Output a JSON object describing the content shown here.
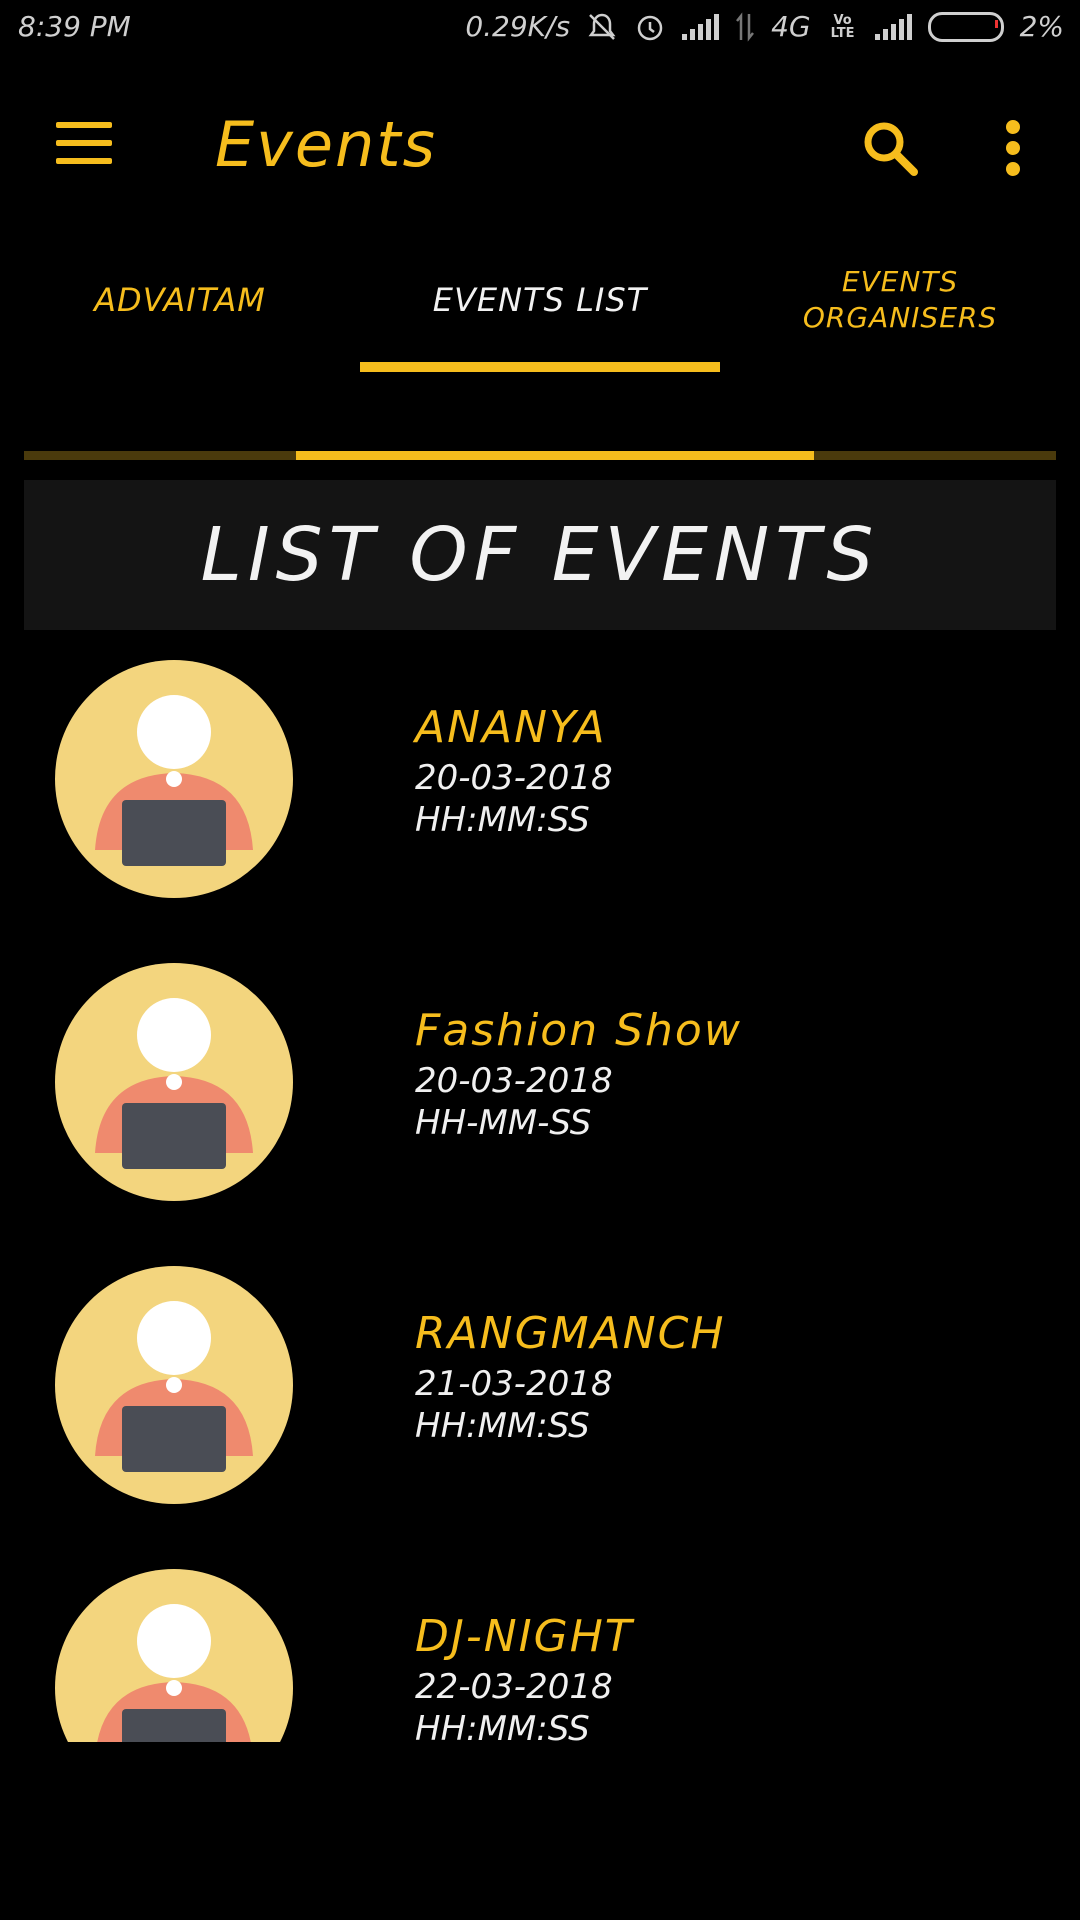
{
  "status_bar": {
    "time": "8:39 PM",
    "speed": "0.29K/s",
    "network": "4G",
    "volte": "Vo LTE",
    "battery": "2%"
  },
  "app_bar": {
    "title": "Events"
  },
  "tabs": [
    {
      "label": "ADVAITAM",
      "selected": false
    },
    {
      "label": "EVENTS LIST",
      "selected": true
    },
    {
      "label": "EVENTS ORGANISERS",
      "selected": false
    }
  ],
  "header": {
    "title": "LIST OF EVENTS"
  },
  "events": [
    {
      "name": "ANANYA",
      "date": "20-03-2018",
      "time": "HH:MM:SS"
    },
    {
      "name": "Fashion Show",
      "date": "20-03-2018",
      "time": "HH-MM-SS"
    },
    {
      "name": "RANGMANCH",
      "date": "21-03-2018",
      "time": "HH:MM:SS"
    },
    {
      "name": "DJ-NIGHT",
      "date": "22-03-2018",
      "time": "HH:MM:SS"
    }
  ],
  "colors": {
    "accent": "#f6bd1d",
    "background": "#000000",
    "banner": "#141414",
    "avatar_bg": "#f3d57e",
    "avatar_shirt": "#ef8a6e",
    "avatar_laptop": "#4a4d55"
  },
  "icons": [
    "menu-icon",
    "search-icon",
    "more-vert-icon",
    "bell-off-icon",
    "alarm-icon",
    "signal-icon",
    "battery-icon",
    "person-laptop-avatar-icon"
  ]
}
